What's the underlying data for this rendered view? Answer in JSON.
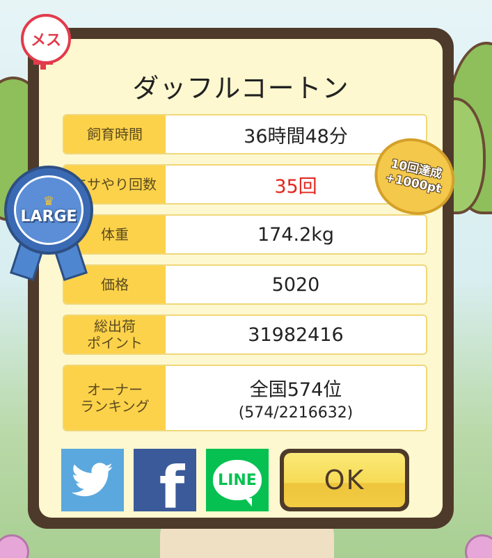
{
  "dialog": {
    "title": "ダッフルコートン",
    "rows": [
      {
        "label": "飼育時間",
        "value": "36時間48分"
      },
      {
        "label": "エサやり回数",
        "value": "35回"
      },
      {
        "label": "体重",
        "value": "174.2kg"
      },
      {
        "label": "価格",
        "value": "5020"
      },
      {
        "label": "総出荷\nポイント",
        "value": "31982416"
      },
      {
        "label": "オーナー\nランキング",
        "value": "全国574位",
        "sub": "(574/2216632)"
      }
    ],
    "ok_label": "OK"
  },
  "badges": {
    "gender": "メス",
    "size_ribbon": "LARGE",
    "achievement_line1": "10回達成",
    "achievement_line2": "+1000pt"
  },
  "social": {
    "line_label": "LINE"
  },
  "colors": {
    "label_bg": "#fcd24a",
    "accent_red": "#e0261c",
    "frame": "#4e3a2a",
    "panel": "#fdf8cf"
  },
  "icons": [
    "twitter-icon",
    "facebook-icon",
    "line-icon",
    "female-symbol-icon",
    "crown-icon"
  ]
}
